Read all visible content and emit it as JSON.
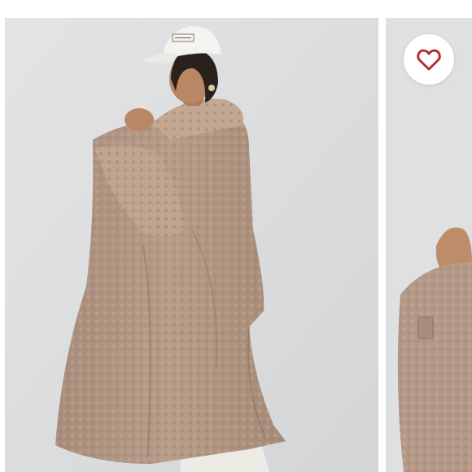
{
  "colors": {
    "background": "#ffffff",
    "studio_backdrop": "#dcdddf",
    "coat": "#b49886",
    "coat_shadow": "#a08472",
    "coat_highlight": "#c5ab99",
    "cap": "#f4f3ef",
    "trousers": "#ecebe6",
    "skin": "#b98764",
    "heart": "#b02a2a"
  },
  "gallery": {
    "slides": [
      {
        "image_subject": "teddy-coat-model-back-view"
      },
      {
        "image_subject": "teddy-coat-sleeve-detail"
      }
    ]
  },
  "wishlist": {
    "icon": "heart-outline-icon",
    "active": false
  }
}
